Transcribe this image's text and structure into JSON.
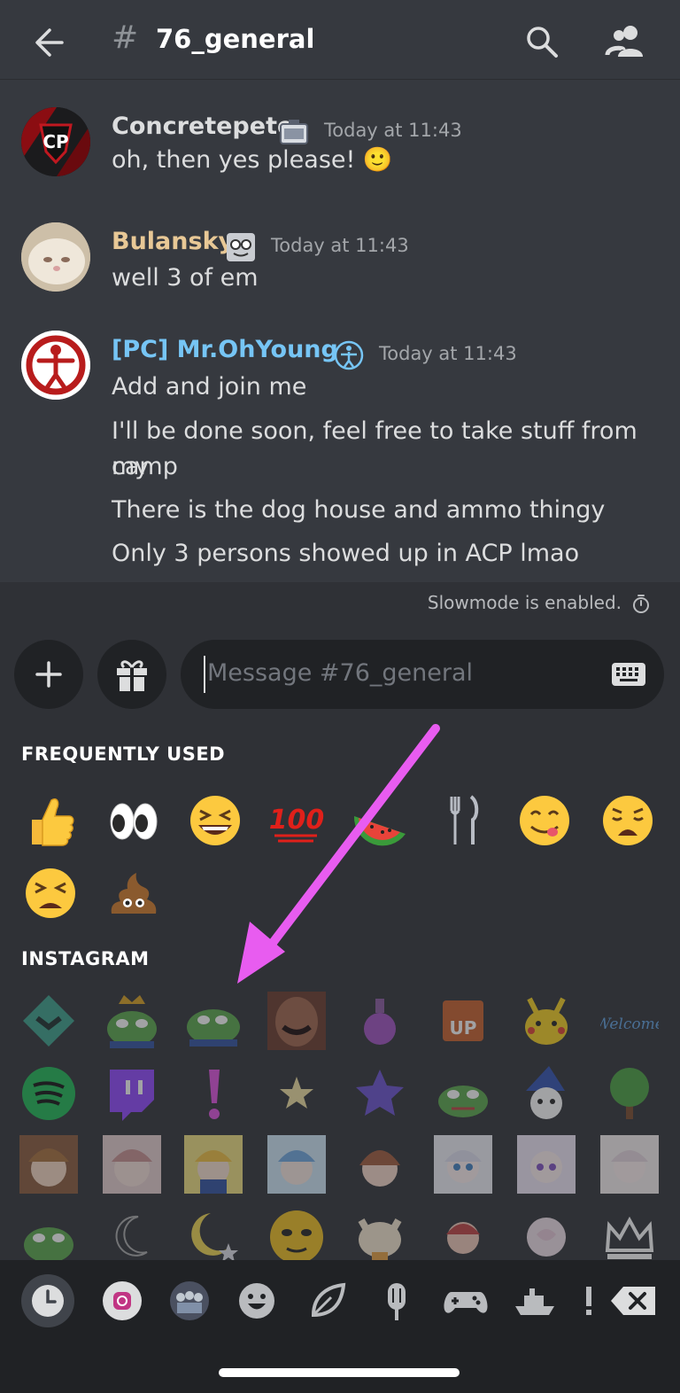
{
  "header": {
    "channel_hash": "#",
    "channel_name": "76_general",
    "icons": [
      "back-arrow-icon",
      "search-icon",
      "members-icon"
    ]
  },
  "messages": [
    {
      "author": "Concretepete",
      "author_color": "#dcddde",
      "timestamp": "Today at 11:43",
      "lines": [
        "oh, then yes please! 🙂"
      ]
    },
    {
      "author": "Bulansky",
      "author_color": "#e8c896",
      "timestamp": "Today at 11:43",
      "lines": [
        "well 3 of em"
      ]
    },
    {
      "author": "[PC] Mr.OhYoung",
      "author_color": "#76c5f5",
      "timestamp": "Today at 11:43",
      "lines": [
        "Add and join me",
        "I'll be done soon, feel free to take stuff from my",
        "camp",
        "There is the dog house and ammo thingy",
        "Only 3 persons showed up in ACP lmao"
      ]
    }
  ],
  "slowmode": {
    "text": "Slowmode is enabled."
  },
  "composer": {
    "placeholder": "Message #76_general",
    "buttons": [
      "plus-icon",
      "gift-icon",
      "keyboard-icon"
    ]
  },
  "picker": {
    "frequent_title": "FREQUENTLY USED",
    "frequent": [
      "👍",
      "👀",
      "😆",
      "💯",
      "🍉",
      "🍴",
      "😋",
      "😩",
      "😫",
      "💩"
    ],
    "instagram_title": "INSTAGRAM",
    "instagram_row1_text": {
      "up": "UP",
      "welcome": "Welcome"
    },
    "tabs": [
      "recent-clock-icon",
      "instagram-server-icon",
      "server-group-icon",
      "smiley-icon",
      "leaf-icon",
      "popsicle-icon",
      "gamepad-icon",
      "ship-icon",
      "symbols-icon",
      "backspace-icon"
    ]
  },
  "colors": {
    "background": "#36393f",
    "annotation_arrow": "#e85cf0",
    "accent_link": "#76c5f5"
  }
}
